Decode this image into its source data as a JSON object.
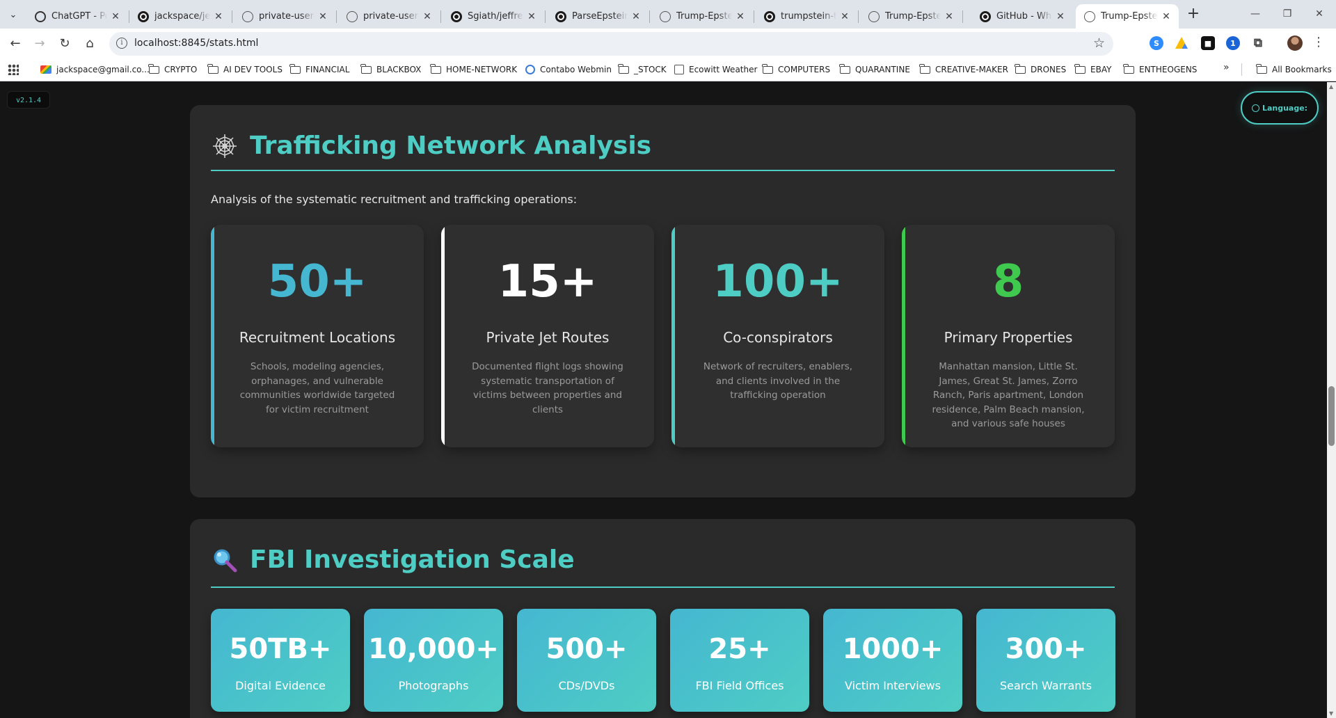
{
  "browser": {
    "tabs": [
      {
        "title": "ChatGPT - Poli",
        "icon": "chatgpt-icon"
      },
      {
        "title": "jackspace/jeffr",
        "icon": "github-icon"
      },
      {
        "title": "private-user-im",
        "icon": "globe-icon"
      },
      {
        "title": "private-user-im",
        "icon": "globe-icon"
      },
      {
        "title": "Sgiath/jeffrey-",
        "icon": "github-icon"
      },
      {
        "title": "ParseEpsteinLo",
        "icon": "github-icon"
      },
      {
        "title": "Trump-Epstein",
        "icon": "globe-icon"
      },
      {
        "title": "trumpstein-tim",
        "icon": "github-icon"
      },
      {
        "title": "Trump-Epstein",
        "icon": "globe-icon"
      },
      {
        "title": "GitHub - Where",
        "icon": "github-icon"
      },
      {
        "title": "Trump-Epstein",
        "icon": "globe-icon",
        "active": true
      }
    ],
    "url": "localhost:8845/stats.html",
    "bookmarks": [
      {
        "label": "jackspace@gmail.co...",
        "icon": "gmail-icon"
      },
      {
        "label": "CRYPTO",
        "icon": "folder-icon"
      },
      {
        "label": "AI DEV TOOLS",
        "icon": "folder-icon"
      },
      {
        "label": "FINANCIAL",
        "icon": "folder-icon"
      },
      {
        "label": "BLACKBOX",
        "icon": "folder-icon"
      },
      {
        "label": "HOME-NETWORK",
        "icon": "folder-icon"
      },
      {
        "label": "Contabo Webmin",
        "icon": "webmin-icon"
      },
      {
        "label": "_STOCK",
        "icon": "folder-icon"
      },
      {
        "label": "Ecowitt Weather",
        "icon": "weather-icon"
      },
      {
        "label": "COMPUTERS",
        "icon": "folder-icon"
      },
      {
        "label": "QUARANTINE",
        "icon": "folder-icon"
      },
      {
        "label": "CREATIVE-MAKER",
        "icon": "folder-icon"
      },
      {
        "label": "DRONES",
        "icon": "folder-icon"
      },
      {
        "label": "EBAY",
        "icon": "folder-icon"
      },
      {
        "label": "ENTHEOGENS",
        "icon": "folder-icon"
      }
    ],
    "bookmarks_more": "»",
    "all_bookmarks": "All Bookmarks"
  },
  "page": {
    "version": "v2.1.4",
    "language_label": "Language:",
    "trafficking": {
      "icon": "spider-web-icon",
      "title": "Trafficking Network Analysis",
      "description": "Analysis of the systematic recruitment and trafficking operations:",
      "cards": [
        {
          "number": "50+",
          "label": "Recruitment Locations",
          "description": "Schools, modeling agencies, orphanages, and vulnerable communities worldwide targeted for victim recruitment",
          "color": "#45b7d1"
        },
        {
          "number": "15+",
          "label": "Private Jet Routes",
          "description": "Documented flight logs showing systematic transportation of victims between properties and clients",
          "color": "#ffffff"
        },
        {
          "number": "100+",
          "label": "Co-conspirators",
          "description": "Network of recruiters, enablers, and clients involved in the trafficking operation",
          "color": "#4ecdc4"
        },
        {
          "number": "8",
          "label": "Primary Properties",
          "description": "Manhattan mansion, Little St. James, Great St. James, Zorro Ranch, Paris apartment, London residence, Palm Beach mansion, and various safe houses",
          "color": "#3fc94f"
        }
      ]
    },
    "fbi": {
      "icon": "magnifying-glass-icon",
      "title": "FBI Investigation Scale",
      "cards": [
        {
          "number": "50TB+",
          "label": "Digital Evidence"
        },
        {
          "number": "10,000+",
          "label": "Photographs"
        },
        {
          "number": "500+",
          "label": "CDs/DVDs"
        },
        {
          "number": "25+",
          "label": "FBI Field Offices"
        },
        {
          "number": "1000+",
          "label": "Victim Interviews"
        },
        {
          "number": "300+",
          "label": "Search Warrants"
        }
      ]
    }
  }
}
